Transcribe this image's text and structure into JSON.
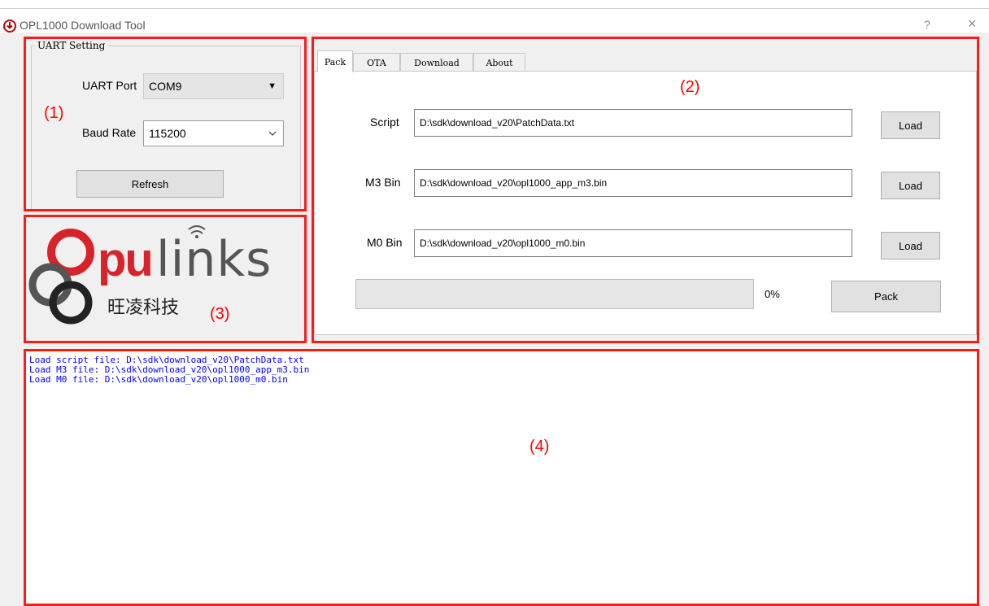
{
  "window": {
    "title": "OPL1000 Download Tool",
    "help_label": "?",
    "close_label": "×"
  },
  "uart": {
    "group_title": "UART Setting",
    "port_label": "UART Port",
    "port_value": "COM9",
    "baud_label": "Baud Rate",
    "baud_value": "115200",
    "refresh_label": "Refresh"
  },
  "tabs": [
    {
      "label": "Pack",
      "active": true
    },
    {
      "label": "OTA",
      "active": false
    },
    {
      "label": "Download",
      "active": false
    },
    {
      "label": "About",
      "active": false
    }
  ],
  "pack": {
    "script_label": "Script",
    "script_value": "D:\\sdk\\download_v20\\PatchData.txt",
    "m3_label": "M3 Bin",
    "m3_value": "D:\\sdk\\download_v20\\opl1000_app_m3.bin",
    "m0_label": "M0 Bin",
    "m0_value": "D:\\sdk\\download_v20\\opl1000_m0.bin",
    "load_label": "Load",
    "progress_percent": 0,
    "progress_text": "0%",
    "pack_label": "Pack"
  },
  "logo": {
    "brand": "Opulinks",
    "chinese": "旺凌科技"
  },
  "log": {
    "lines": [
      "Load script file: D:\\sdk\\download_v20\\PatchData.txt",
      "Load M3 file: D:\\sdk\\download_v20\\opl1000_app_m3.bin",
      "Load M0 file: D:\\sdk\\download_v20\\opl1000_m0.bin"
    ]
  },
  "annotations": {
    "label1": "(1)",
    "label2": "(2)",
    "label3": "(3)",
    "label4": "(4)",
    "color": "#ff0000"
  }
}
